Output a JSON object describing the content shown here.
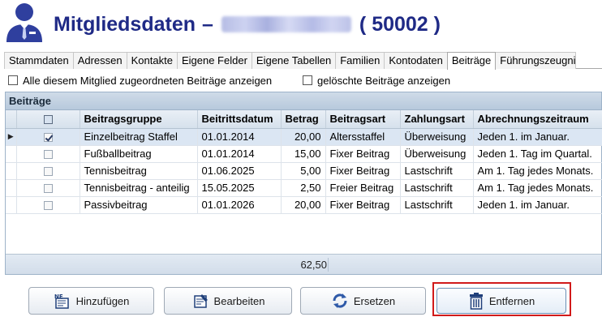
{
  "header": {
    "title": "Mitgliedsdaten",
    "dash": "–",
    "member_id": "( 50002 )",
    "icon": "user-suit-icon"
  },
  "tabs": [
    {
      "label": "Stammdaten",
      "active": false
    },
    {
      "label": "Adressen",
      "active": false
    },
    {
      "label": "Kontakte",
      "active": false
    },
    {
      "label": "Eigene Felder",
      "active": false
    },
    {
      "label": "Eigene Tabellen",
      "active": false
    },
    {
      "label": "Familien",
      "active": false
    },
    {
      "label": "Kontodaten",
      "active": false
    },
    {
      "label": "Beiträge",
      "active": true
    },
    {
      "label": "Führungszeugni",
      "active": false
    }
  ],
  "options": {
    "show_all_label": "Alle diesem Mitglied zugeordneten Beiträge anzeigen",
    "show_deleted_label": "gelöschte Beiträge anzeigen"
  },
  "grid": {
    "title": "Beiträge",
    "columns": {
      "gruppe": "Beitragsgruppe",
      "datum": "Beitrittsdatum",
      "betrag": "Betrag",
      "art": "Beitragsart",
      "zahlung": "Zahlungsart",
      "zeitraum": "Abrechnungszeitraum"
    },
    "rows": [
      {
        "gruppe": "Einzelbeitrag Staffel",
        "datum": "01.01.2014",
        "betrag": "20,00",
        "art": "Altersstaffel",
        "zahlung": "Überweisung",
        "zeitraum": "Jeden 1. im Januar."
      },
      {
        "gruppe": "Fußballbeitrag",
        "datum": "01.01.2014",
        "betrag": "15,00",
        "art": "Fixer Beitrag",
        "zahlung": "Überweisung",
        "zeitraum": "Jeden 1. Tag im Quartal."
      },
      {
        "gruppe": "Tennisbeitrag",
        "datum": "01.06.2025",
        "betrag": "5,00",
        "art": "Fixer Beitrag",
        "zahlung": "Lastschrift",
        "zeitraum": "Am 1. Tag jedes Monats."
      },
      {
        "gruppe": "Tennisbeitrag - anteilig",
        "datum": "15.05.2025",
        "betrag": "2,50",
        "art": "Freier Beitrag",
        "zahlung": "Lastschrift",
        "zeitraum": "Am 1. Tag jedes Monats."
      },
      {
        "gruppe": "Passivbeitrag",
        "datum": "01.01.2026",
        "betrag": "20,00",
        "art": "Fixer Beitrag",
        "zahlung": "Lastschrift",
        "zeitraum": "Jeden 1. im Januar."
      }
    ],
    "total": "62,50"
  },
  "buttons": {
    "add": "Hinzufügen",
    "edit": "Bearbeiten",
    "replace": "Ersetzen",
    "remove": "Entfernen"
  },
  "colors": {
    "title": "#1f2a86",
    "highlight": "#d11a1a",
    "selected_row": "#dbe6f3"
  }
}
